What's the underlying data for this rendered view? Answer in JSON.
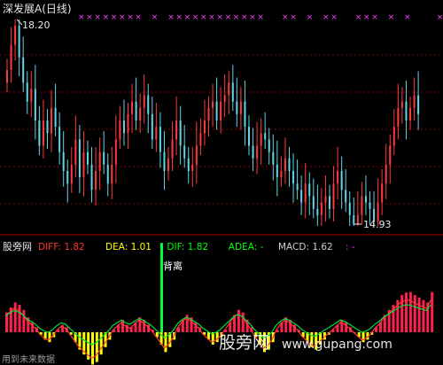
{
  "main_title": "深发展A(日线)",
  "high_label": "18.20",
  "low_label": "14.93",
  "indicator_name": "股旁网",
  "indicator_line": [
    {
      "text": "DIFF: 1.82",
      "color": "#ff3030"
    },
    {
      "text": "DEA: 1.01",
      "color": "#ffff00"
    },
    {
      "text": "DIF: 1.82",
      "color": "#00ff00"
    },
    {
      "text": "ADEA: -",
      "color": "#00ff00"
    },
    {
      "text": "MACD: 1.62",
      "color": "#d0d0d0"
    },
    {
      "text": ": -",
      "color": "#ff30ff"
    }
  ],
  "annotation": "背离",
  "watermark_brand": "股旁网",
  "watermark_url": "www.gupang.com",
  "bottom_tag": "用到未来数据",
  "colors": {
    "up": "#ff3a3a",
    "down": "#5fd7e8",
    "grid": "#8a0000",
    "marker": "#ff40ff",
    "macd_pos": "#ff2050",
    "macd_neg": "#ffff00"
  },
  "chart_data": [
    {
      "type": "candlestick",
      "title": "深发展A(日线)",
      "closes": [
        17.4,
        17.8,
        18.1,
        17.6,
        17.2,
        16.9,
        17.1,
        16.6,
        16.2,
        16.6,
        16.4,
        16.8,
        16.5,
        16.1,
        15.8,
        15.6,
        15.9,
        16.3,
        15.7,
        16.1,
        15.9,
        15.5,
        15.8,
        16.1,
        15.9,
        15.6,
        15.9,
        16.3,
        16.6,
        16.4,
        16.7,
        16.9,
        16.6,
        16.8,
        17.0,
        16.7,
        16.3,
        16.5,
        16.1,
        15.8,
        16.0,
        16.3,
        16.6,
        16.2,
        16.0,
        15.8,
        15.9,
        16.2,
        16.4,
        16.6,
        16.8,
        16.9,
        16.6,
        16.9,
        17.0,
        17.2,
        16.9,
        16.7,
        16.9,
        16.5,
        16.2,
        16.0,
        16.2,
        16.4,
        16.3,
        16.1,
        15.9,
        15.7,
        15.8,
        16.0,
        15.8,
        15.6,
        15.5,
        15.3,
        15.6,
        15.4,
        15.2,
        15.1,
        15.3,
        15.4,
        15.2,
        15.6,
        15.8,
        15.5,
        15.3,
        15.1,
        14.95,
        15.1,
        15.4,
        15.3,
        15.2,
        15.0,
        15.3,
        15.6,
        15.9,
        16.2,
        16.5,
        16.8,
        16.9,
        16.6,
        16.8,
        17.0,
        16.7
      ],
      "max": 18.2,
      "min": 14.93,
      "markers": "xxxxxxxx·x·xxxxxxxxxxxx··xx·x·xx··xxx·x·x···x"
    },
    {
      "type": "bar",
      "title": "股旁网",
      "series": [
        {
          "name": "DIFF",
          "value": 1.82
        },
        {
          "name": "DEA",
          "value": 1.01
        },
        {
          "name": "DIF",
          "value": 1.82
        },
        {
          "name": "MACD",
          "value": 1.62
        }
      ],
      "macd_values": [
        0.8,
        1.0,
        1.2,
        1.1,
        0.9,
        0.6,
        0.4,
        0.2,
        -0.1,
        -0.3,
        -0.4,
        -0.2,
        0.1,
        0.3,
        0.2,
        -0.1,
        -0.4,
        -0.7,
        -0.9,
        -1.1,
        -1.3,
        -1.2,
        -0.9,
        -0.6,
        -0.3,
        0.1,
        0.3,
        0.5,
        0.3,
        0.2,
        0.4,
        0.6,
        0.5,
        0.3,
        0.1,
        -0.2,
        -0.5,
        -0.8,
        -0.6,
        -0.3,
        0.2,
        0.5,
        0.7,
        0.6,
        0.4,
        0.2,
        -0.1,
        -0.3,
        -0.5,
        -0.4,
        -0.2,
        0.1,
        0.4,
        0.7,
        0.9,
        0.8,
        0.5,
        0.2,
        -0.2,
        -0.5,
        -0.8,
        -0.7,
        -0.4,
        0.1,
        0.4,
        0.6,
        0.5,
        0.3,
        0.1,
        -0.2,
        -0.4,
        -0.6,
        -0.7,
        -0.5,
        -0.3,
        -0.1,
        0.1,
        0.3,
        0.5,
        0.4,
        0.2,
        0.0,
        -0.2,
        -0.4,
        -0.3,
        -0.1,
        0.2,
        0.4,
        0.7,
        0.9,
        1.1,
        1.3,
        1.5,
        1.6,
        1.62,
        1.5,
        1.4,
        1.3,
        1.2,
        1.62
      ],
      "spike_value": 3.6
    }
  ]
}
